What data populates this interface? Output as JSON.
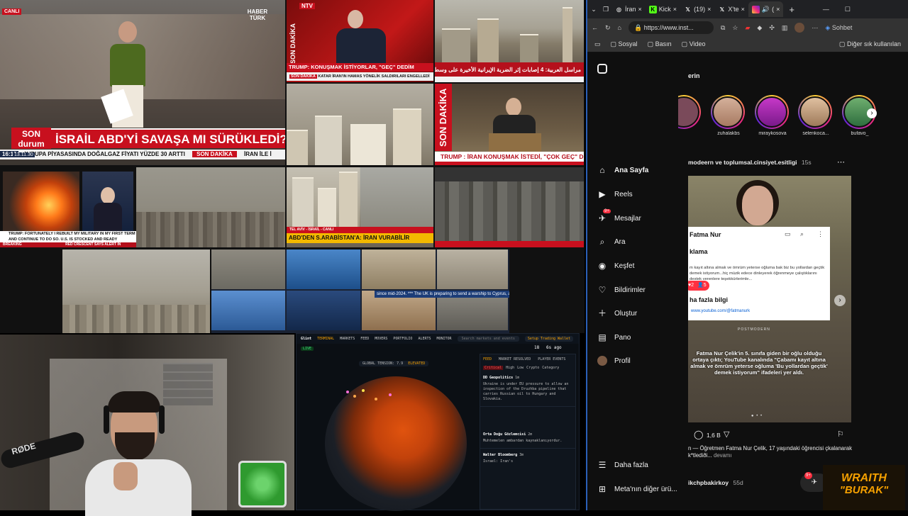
{
  "video_wall": {
    "habertürk": {
      "live": "CANLI",
      "logo": "HABER TÜRK",
      "badge": "SON durum",
      "headline": "İSRAİL ABD'Yİ SAVAŞA MI SÜRÜKLEDİ?",
      "time": "16:12",
      "ticker": "AVRUPA PİYASASINDA DOĞALGAZ FİYATI YÜZDE 30 ARTTI",
      "ticker_tag": "SON DAKİKA",
      "ticker_tail": "İRAN İLE İ",
      "clock": "13.11.30"
    },
    "ntv": {
      "logo": "NTV",
      "side_label": "SON DAKİKA",
      "headline": "TRUMP: KONUŞMAK İSTİYORLAR, \"GEÇ\" DEDİM",
      "sub": "KATAR İRAN'IN HAMAS YÖNELİK SALDIRILARI ENGELLEDİ",
      "sub_tag": "SON DAKİKA"
    },
    "alarabiya": {
      "headline": "مراسل العربية: 4 إصابات إثر الضربة الإيرانية الأخيرة على وسط إسرائيل"
    },
    "sondakika": {
      "side_label": "SON DAKİKA",
      "headline": "TRUMP : İRAN KONUŞMAK İSTEDİ, \"ÇOK GEÇ\" DEDİM"
    },
    "cnn": {
      "ticker": "TRUMP: FORTUNATELY I REBUILT MY MILITARY IN MY FIRST TERM AND CONTINUE TO DO SO. U.S. IS STOCKED AND READY",
      "tag": "BREAKING",
      "tail": "RED CRESCENT SAYS ALERT IN"
    },
    "abd_tile": {
      "tag": "SON DAKİKA",
      "headline": "ABD'DEN S.ARABİSTAN'A: İRAN VURABİLİR",
      "caption": "TEL AVİV - İSRAİL - CANLI"
    },
    "marquee": {
      "text": "since mid-2024. *** The UK is preparing to send a warship to Cyprus, accordin"
    }
  },
  "terminal": {
    "brand": "Glint",
    "nav": [
      "TERMINAL",
      "MARKETS",
      "FEED",
      "MOVERS",
      "PORTFOLIO",
      "ALERTS",
      "MONITOR"
    ],
    "search_placeholder": "Search markets and events",
    "setup": "Setup Trading Wallet",
    "live_tag": "LIVE",
    "global_tension": "GLOBAL TENSION: 7.9",
    "tension_label": "ELEVATED",
    "stat_value": "18",
    "stat_label": "6s ago",
    "panel_tabs": [
      "FEED",
      "MARKET RESOLVED",
      "PLAYER EVENTS"
    ],
    "filters": [
      "Critical",
      "High",
      "Low",
      "Crypto",
      "Category"
    ],
    "posts": [
      {
        "author": "DD Geopolitics",
        "time": "1m",
        "text": "Ukraine is under EU pressure to allow an inspection of the Druzhba pipeline that carries Russian oil to Hungary and Slovakia."
      },
      {
        "author": "Orta Doğu Gözlemcisi",
        "time": "2m",
        "text": "Muhtemelen ambardan kaynaklanıyordur."
      },
      {
        "author": "Walter Bloomberg",
        "time": "3m",
        "text": "Israel: Iran's"
      }
    ]
  },
  "browser": {
    "tabs": [
      "İran",
      "Kick",
      "(19)",
      "X'te",
      "("
    ],
    "url": "https://www.inst...",
    "bookmarks": [
      "Sosyal",
      "Basın",
      "Video"
    ],
    "other_bookmarks": "Diğer sık kullanılan",
    "copilot": "Sohbet",
    "nav": [
      {
        "label": "Ana Sayfa",
        "icon": "home-icon"
      },
      {
        "label": "Reels",
        "icon": "reels-icon"
      },
      {
        "label": "Mesajlar",
        "icon": "messenger-icon",
        "badge": "9+"
      },
      {
        "label": "Ara",
        "icon": "search-icon"
      },
      {
        "label": "Keşfet",
        "icon": "explore-icon"
      },
      {
        "label": "Bildirimler",
        "icon": "heart-icon"
      },
      {
        "label": "Oluştur",
        "icon": "plus-icon"
      },
      {
        "label": "Pano",
        "icon": "dashboard-icon"
      },
      {
        "label": "Profil",
        "icon": "avatar"
      }
    ],
    "more": "Daha fazla",
    "meta": "Meta'nın diğer ürü...",
    "stories_header": "erin",
    "stories": [
      "",
      "zuhalakbs",
      "miraykosova",
      "selenkoca...",
      "bufavo_"
    ],
    "post": {
      "author": "modeern ve toplumsal.cinsiyet.esitligi",
      "age": "15s",
      "card_title": "Fatma Nur",
      "card_heading": "klama",
      "card_text": "m kayıt altına almak ve ömrüm yeterse oğluma bak biz bu yollardan geçtik demek istiyorum...hiç müzik edece dinleyerek öğrenmeye çalıştıklarını destek verenlere teşekkürlerimle...",
      "card_more": "ha fazla bilgi",
      "card_link": "www.youtube.com/@fatmanurk",
      "notif_likes": "2",
      "notif_follows": "5",
      "watermark": "POSTMODERN",
      "overlay": "Fatma Nur Çelik'in 5. sınıfa giden bir oğlu olduğu ortaya çıktı; YouTube kanalında \"Çabamı kayıt altına almak ve ömrüm yeterse oğluma 'Bu yollardan geçtik' demek istiyorum\" ifadeleri yer aldı.",
      "likes": "1,6 B",
      "caption": "n — Öğretmen Fatma Nur Çelik, 17 yaşındaki öğrencisi çkalanarak k*tlediði...",
      "caption_more": "devamı"
    },
    "next_author": "ikchpbakirkoy",
    "next_age": "55d",
    "messages_badge": "9+"
  },
  "streamer": {
    "mic_brand": "RØDE"
  },
  "overlay_logo": {
    "line1": "WRAITH",
    "line2": "\"BURAK\""
  },
  "colors": {
    "news_red": "#c8101e",
    "insta_blue": "#0095f6",
    "border_blue": "#2a5fb8",
    "gold": "#f5a000"
  }
}
